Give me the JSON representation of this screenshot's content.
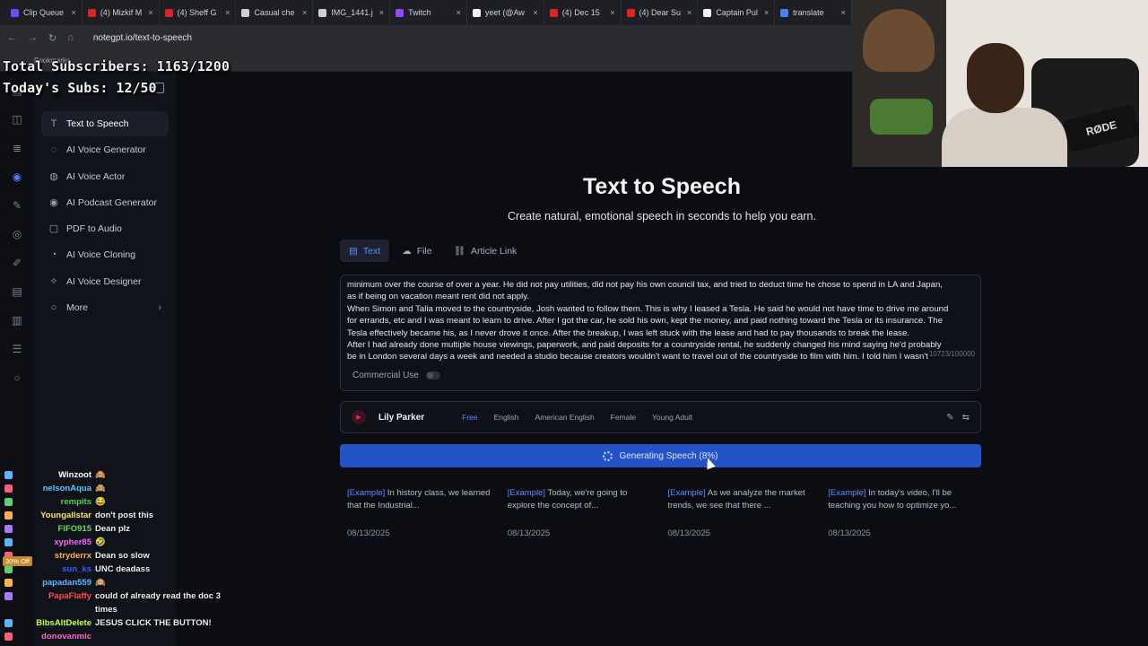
{
  "browser": {
    "tabs": [
      {
        "label": "Clip Queue",
        "color": "#6b4cff"
      },
      {
        "label": "(4) Mizkif M",
        "color": "#e02424"
      },
      {
        "label": "(4) Sheff G",
        "color": "#e02424"
      },
      {
        "label": "Casual che",
        "color": "#cfcfcf"
      },
      {
        "label": "IMG_1441.j",
        "color": "#d0d0d0"
      },
      {
        "label": "Twitch",
        "color": "#9146ff"
      },
      {
        "label": "yeet (@Aw",
        "color": "#f0f0f0"
      },
      {
        "label": "(4) Dec 15",
        "color": "#e02424"
      },
      {
        "label": "(4) Dear Su",
        "color": "#e02424"
      },
      {
        "label": "Captain Pul",
        "color": "#f0f0f0"
      },
      {
        "label": "translate",
        "color": "#4285f4"
      }
    ],
    "url": "notegpt.io/text-to-speech",
    "bookmarks_label": "Bookmarks"
  },
  "overlay": {
    "total_subs": "Total Subscribers: 1163/1200",
    "todays_subs": "Today's Subs: 12/50"
  },
  "sidebar": {
    "items": [
      {
        "label": "Text to Speech",
        "icon": "text-box-icon"
      },
      {
        "label": "AI Voice Generator",
        "icon": "voice-icon"
      },
      {
        "label": "AI Voice Actor",
        "icon": "actor-icon"
      },
      {
        "label": "AI Podcast Generator",
        "icon": "podcast-icon"
      },
      {
        "label": "PDF to Audio",
        "icon": "pdf-icon"
      },
      {
        "label": "AI Voice Cloning",
        "icon": "clone-icon"
      },
      {
        "label": "AI Voice Designer",
        "icon": "designer-icon"
      },
      {
        "label": "More",
        "icon": "more-icon"
      }
    ]
  },
  "main": {
    "title": "Text to Speech",
    "subtitle": "Create natural, emotional speech in seconds to help you earn.",
    "mode_tabs": [
      "Text",
      "File",
      "Article Link"
    ],
    "editor": {
      "lines": [
        "minimum over the course of over a year. He did not pay utilities, did not pay his own council tax, and tried to deduct time he chose to spend in LA and Japan,",
        "as if being on vacation meant rent did not apply.",
        "When Simon and Talia moved to the countryside, Josh wanted to follow them. This is why I leased a Tesla. He said he would not have time to drive me around",
        "for errands, etc and I was meant to learn to drive. After I got the car, he sold his own, kept the money, and paid nothing toward the Tesla or its insurance. The",
        "Tesla effectively became his, as I never drove it once. After the breakup, I was left stuck with the lease and had to pay thousands to break the lease.",
        "After I had already done multiple house viewings, paperwork, and paid deposits for a countryside rental, he suddenly changed his mind saying he'd probably",
        "be in London several days a week and needed a studio because creators wouldn't want to travel out of the countryside to film with him. I told him I wasn't"
      ],
      "counter": "10723/100000",
      "commercial_label": "Commercial Use"
    },
    "voice": {
      "name": "Lily Parker",
      "tags": [
        "Free",
        "English",
        "American English",
        "Female",
        "Young Adult"
      ]
    },
    "generate_label": "Generating Speech (8%)",
    "examples": [
      {
        "tag": "[Example]",
        "text": "In history class, we learned that the Industrial...",
        "date": "08/13/2025"
      },
      {
        "tag": "[Example]",
        "text": "Today, we're going to explore the concept of...",
        "date": "08/13/2025"
      },
      {
        "tag": "[Example]",
        "text": "As we analyze the market trends, we see that there ...",
        "date": "08/13/2025"
      },
      {
        "tag": "[Example]",
        "text": "In today's video, I'll be teaching you how to optimize yo...",
        "date": "08/13/2025"
      }
    ]
  },
  "webcam": {
    "mic_brand": "RØDE"
  },
  "chat": {
    "offer_badge": "30% Off",
    "messages": [
      {
        "user": "Winzoot",
        "color": "#ffffff",
        "msg": "🙈"
      },
      {
        "user": "nelsonAqua",
        "color": "#58c8ff",
        "msg": "🙈"
      },
      {
        "user": "rempits",
        "color": "#52d352",
        "msg": "😂"
      },
      {
        "user": "Youngallstar",
        "color": "#ffe066",
        "msg": "don't post this"
      },
      {
        "user": "FIFO915",
        "color": "#6dd66d",
        "msg": "Dean plz"
      },
      {
        "user": "xypher85",
        "color": "#ff66ff",
        "msg": "🤣"
      },
      {
        "user": "stryderrx",
        "color": "#ffb347",
        "msg": "Dean so slow"
      },
      {
        "user": "sun_ks",
        "color": "#3a5cff",
        "msg": "UNC deadass"
      },
      {
        "user": "papadan559",
        "color": "#66b3ff",
        "msg": "🙉"
      },
      {
        "user": "PapaFlaffy",
        "color": "#ff4d4d",
        "msg": "could of already read the doc 3 times"
      },
      {
        "user": "BibsAltDelete",
        "color": "#c6ff4d",
        "msg": "JESUS CLICK THE BUTTON!"
      },
      {
        "user": "donovanmic",
        "color": "#ff66cc",
        "msg": ""
      }
    ]
  },
  "colors": {
    "accent": "#5e8bff",
    "button": "#2453c8",
    "background": "#0b0d13"
  }
}
